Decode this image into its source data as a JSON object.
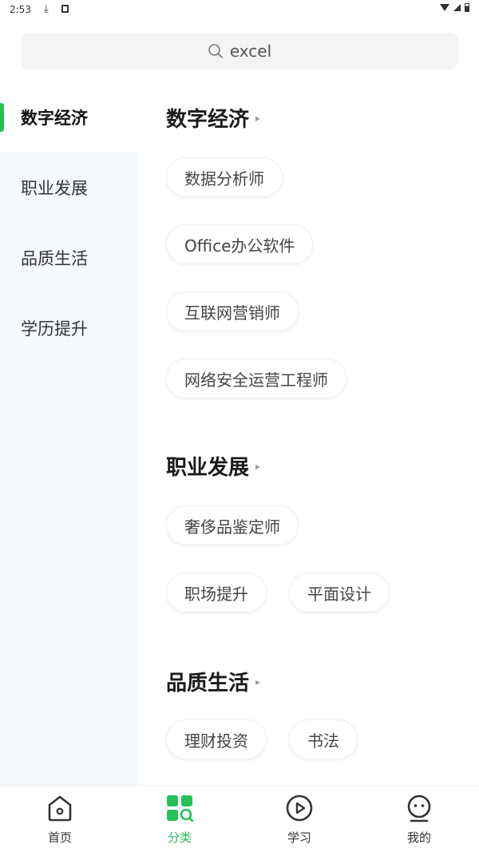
{
  "status_bar": {
    "time": "2:53"
  },
  "search": {
    "query": "excel"
  },
  "sidebar": {
    "items": [
      {
        "label": "数字经济"
      },
      {
        "label": "职业发展"
      },
      {
        "label": "品质生活"
      },
      {
        "label": "学历提升"
      }
    ],
    "active_index": 0
  },
  "sections": [
    {
      "title": "数字经济",
      "chips": [
        "数据分析师",
        "Office办公软件",
        "互联网营销师",
        "网络安全运营工程师"
      ]
    },
    {
      "title": "职业发展",
      "chips": [
        "奢侈品鉴定师",
        "职场提升",
        "平面设计"
      ]
    },
    {
      "title": "品质生活",
      "chips": [
        "理财投资",
        "书法"
      ]
    }
  ],
  "bottom_nav": {
    "items": [
      {
        "label": "首页",
        "icon": "home-icon"
      },
      {
        "label": "分类",
        "icon": "category-icon"
      },
      {
        "label": "学习",
        "icon": "play-icon"
      },
      {
        "label": "我的",
        "icon": "profile-icon"
      }
    ],
    "active_index": 1
  },
  "colors": {
    "accent": "#27c057",
    "sidebar_bg": "#f5f8fc",
    "search_bg": "#f2f4f6"
  }
}
